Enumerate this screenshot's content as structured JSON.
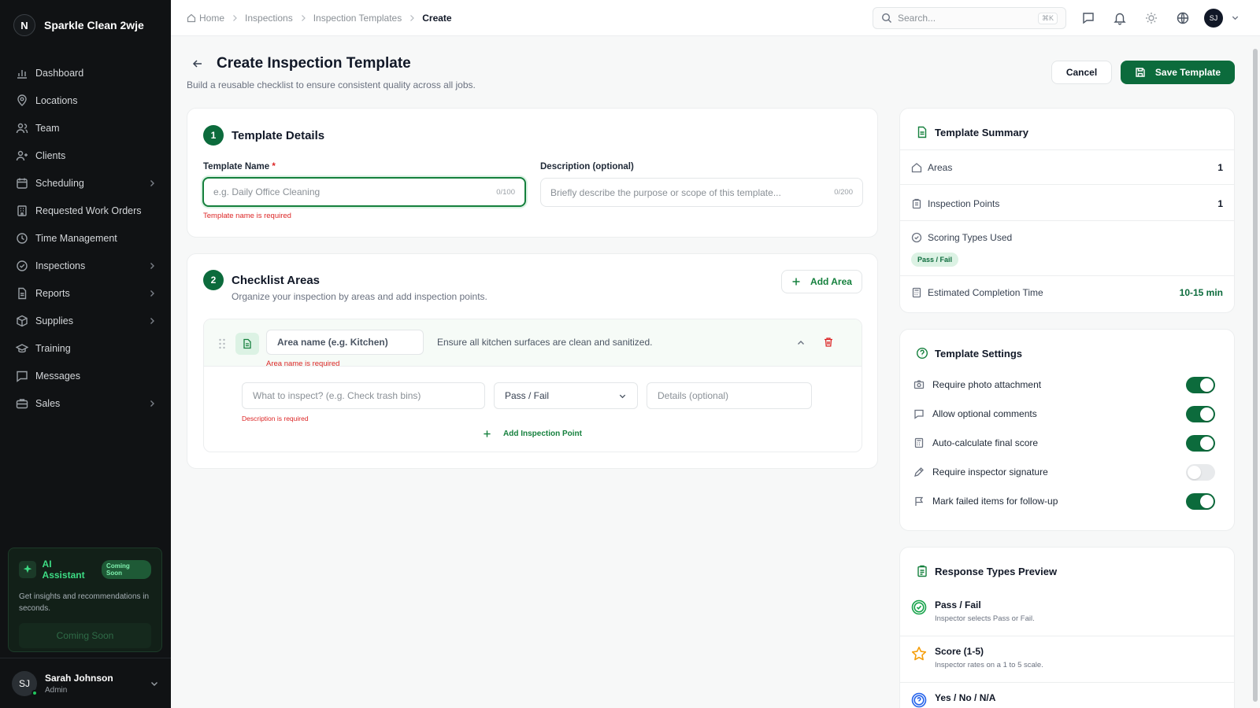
{
  "brand": {
    "logo_letter": "N",
    "name": "Sparkle Clean 2wje"
  },
  "nav": [
    {
      "label": "Dashboard",
      "icon": "chart-icon",
      "chevron": false
    },
    {
      "label": "Locations",
      "icon": "map-pin-icon",
      "chevron": false
    },
    {
      "label": "Team",
      "icon": "users-icon",
      "chevron": false
    },
    {
      "label": "Clients",
      "icon": "user-plus-icon",
      "chevron": false
    },
    {
      "label": "Scheduling",
      "icon": "calendar-icon",
      "chevron": true
    },
    {
      "label": "Requested Work Orders",
      "icon": "building-icon",
      "chevron": false
    },
    {
      "label": "Time Management",
      "icon": "clock-icon",
      "chevron": false
    },
    {
      "label": "Inspections",
      "icon": "check-circle-icon",
      "chevron": true
    },
    {
      "label": "Reports",
      "icon": "file-icon",
      "chevron": true
    },
    {
      "label": "Supplies",
      "icon": "box-icon",
      "chevron": true
    },
    {
      "label": "Training",
      "icon": "graduation-cap-icon",
      "chevron": false
    },
    {
      "label": "Messages",
      "icon": "message-icon",
      "chevron": false
    },
    {
      "label": "Sales",
      "icon": "briefcase-icon",
      "chevron": true
    }
  ],
  "ai_card": {
    "title": "AI Assistant",
    "badge": "Coming Soon",
    "description": "Get insights and recommendations in seconds.",
    "button": "Coming Soon"
  },
  "user": {
    "initials": "SJ",
    "name": "Sarah Johnson",
    "role": "Admin"
  },
  "breadcrumbs": [
    "Home",
    "Inspections",
    "Inspection Templates",
    "Create"
  ],
  "search": {
    "placeholder": "Search...",
    "shortcut": "⌘K"
  },
  "top_avatar": "SJ",
  "page": {
    "title": "Create Inspection Template",
    "subtitle": "Build a reusable checklist to ensure consistent quality across all jobs.",
    "cancel": "Cancel",
    "save": "Save Template"
  },
  "details": {
    "step": "1",
    "title": "Template Details",
    "name_label": "Template Name",
    "required_mark": "*",
    "name_placeholder": "e.g. Daily Office Cleaning",
    "name_counter": "0/100",
    "name_error": "Template name is required",
    "desc_label": "Description (optional)",
    "desc_placeholder": "Briefly describe the purpose or scope of this template...",
    "desc_counter": "0/200"
  },
  "checklist": {
    "step": "2",
    "title": "Checklist Areas",
    "subtitle": "Organize your inspection by areas and add inspection points.",
    "add_area": "Add Area",
    "area": {
      "name_placeholder": "Area name (e.g. Kitchen)",
      "description": "Ensure all kitchen surfaces are clean and sanitized.",
      "name_error": "Area name is required",
      "point_placeholder": "What to inspect? (e.g. Check trash bins)",
      "scoring_value": "Pass / Fail",
      "details_placeholder": "Details (optional)",
      "point_error": "Description is required",
      "add_point": "Add Inspection Point"
    }
  },
  "summary": {
    "title": "Template Summary",
    "areas_label": "Areas",
    "areas_value": "1",
    "points_label": "Inspection Points",
    "points_value": "1",
    "scoring_label": "Scoring Types Used",
    "scoring_pill": "Pass / Fail",
    "time_label": "Estimated Completion Time",
    "time_value": "10-15 min"
  },
  "settings": {
    "title": "Template Settings",
    "items": [
      {
        "label": "Require photo attachment",
        "icon": "camera-icon",
        "on": true
      },
      {
        "label": "Allow optional comments",
        "icon": "comment-icon",
        "on": true
      },
      {
        "label": "Auto-calculate final score",
        "icon": "calculator-icon",
        "on": true
      },
      {
        "label": "Require inspector signature",
        "icon": "pen-icon",
        "on": false
      },
      {
        "label": "Mark failed items for follow-up",
        "icon": "flag-icon",
        "on": true
      }
    ]
  },
  "response_types": {
    "title": "Response Types Preview",
    "items": [
      {
        "title": "Pass / Fail",
        "desc": "Inspector selects Pass or Fail.",
        "icon": "check-badge-icon",
        "color": "#16a34a"
      },
      {
        "title": "Score (1-5)",
        "desc": "Inspector rates on a 1 to 5 scale.",
        "icon": "star-icon",
        "color": "#f59e0b"
      },
      {
        "title": "Yes / No / N/A",
        "desc": "",
        "icon": "question-circle-icon",
        "color": "#2563eb"
      }
    ]
  },
  "colors": {
    "primary": "#0c6b3c",
    "error": "#dc2626",
    "sidebar_bg": "#101214"
  }
}
